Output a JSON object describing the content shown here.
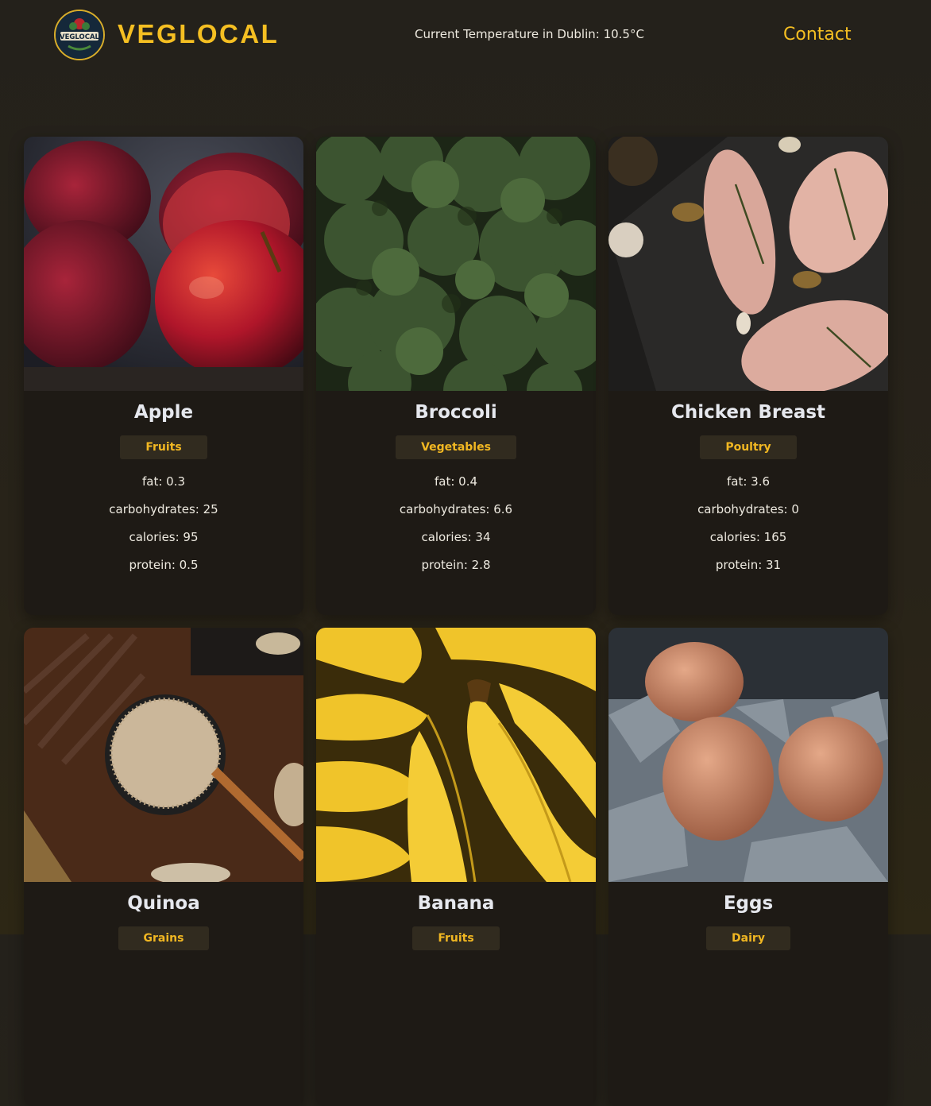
{
  "header": {
    "logo_text": "VEGLOCAL",
    "logo_icon": "veglocal-logo-icon",
    "brand": "VEGLOCAL",
    "temperature": "Current Temperature in Dublin: 10.5°C",
    "contact_label": "Contact"
  },
  "colors": {
    "background": "#25221b",
    "card": "#1e1a15",
    "accent": "#f5bf22",
    "badge_bg": "#312b1f"
  },
  "foods": [
    {
      "name": "Apple",
      "category": "Fruits",
      "image": "apples-photo",
      "stats": [
        "fat: 0.3",
        "carbohydrates: 25",
        "calories: 95",
        "protein: 0.5"
      ]
    },
    {
      "name": "Broccoli",
      "category": "Vegetables",
      "image": "broccoli-photo",
      "stats": [
        "fat: 0.4",
        "carbohydrates: 6.6",
        "calories: 34",
        "protein: 2.8"
      ]
    },
    {
      "name": "Chicken Breast",
      "category": "Poultry",
      "image": "chicken-breast-photo",
      "stats": [
        "fat: 3.6",
        "carbohydrates: 0",
        "calories: 165",
        "protein: 31"
      ]
    },
    {
      "name": "Quinoa",
      "category": "Grains",
      "image": "quinoa-photo",
      "stats": []
    },
    {
      "name": "Banana",
      "category": "Fruits",
      "image": "bananas-photo",
      "stats": []
    },
    {
      "name": "Eggs",
      "category": "Dairy",
      "image": "eggs-photo",
      "stats": []
    }
  ]
}
